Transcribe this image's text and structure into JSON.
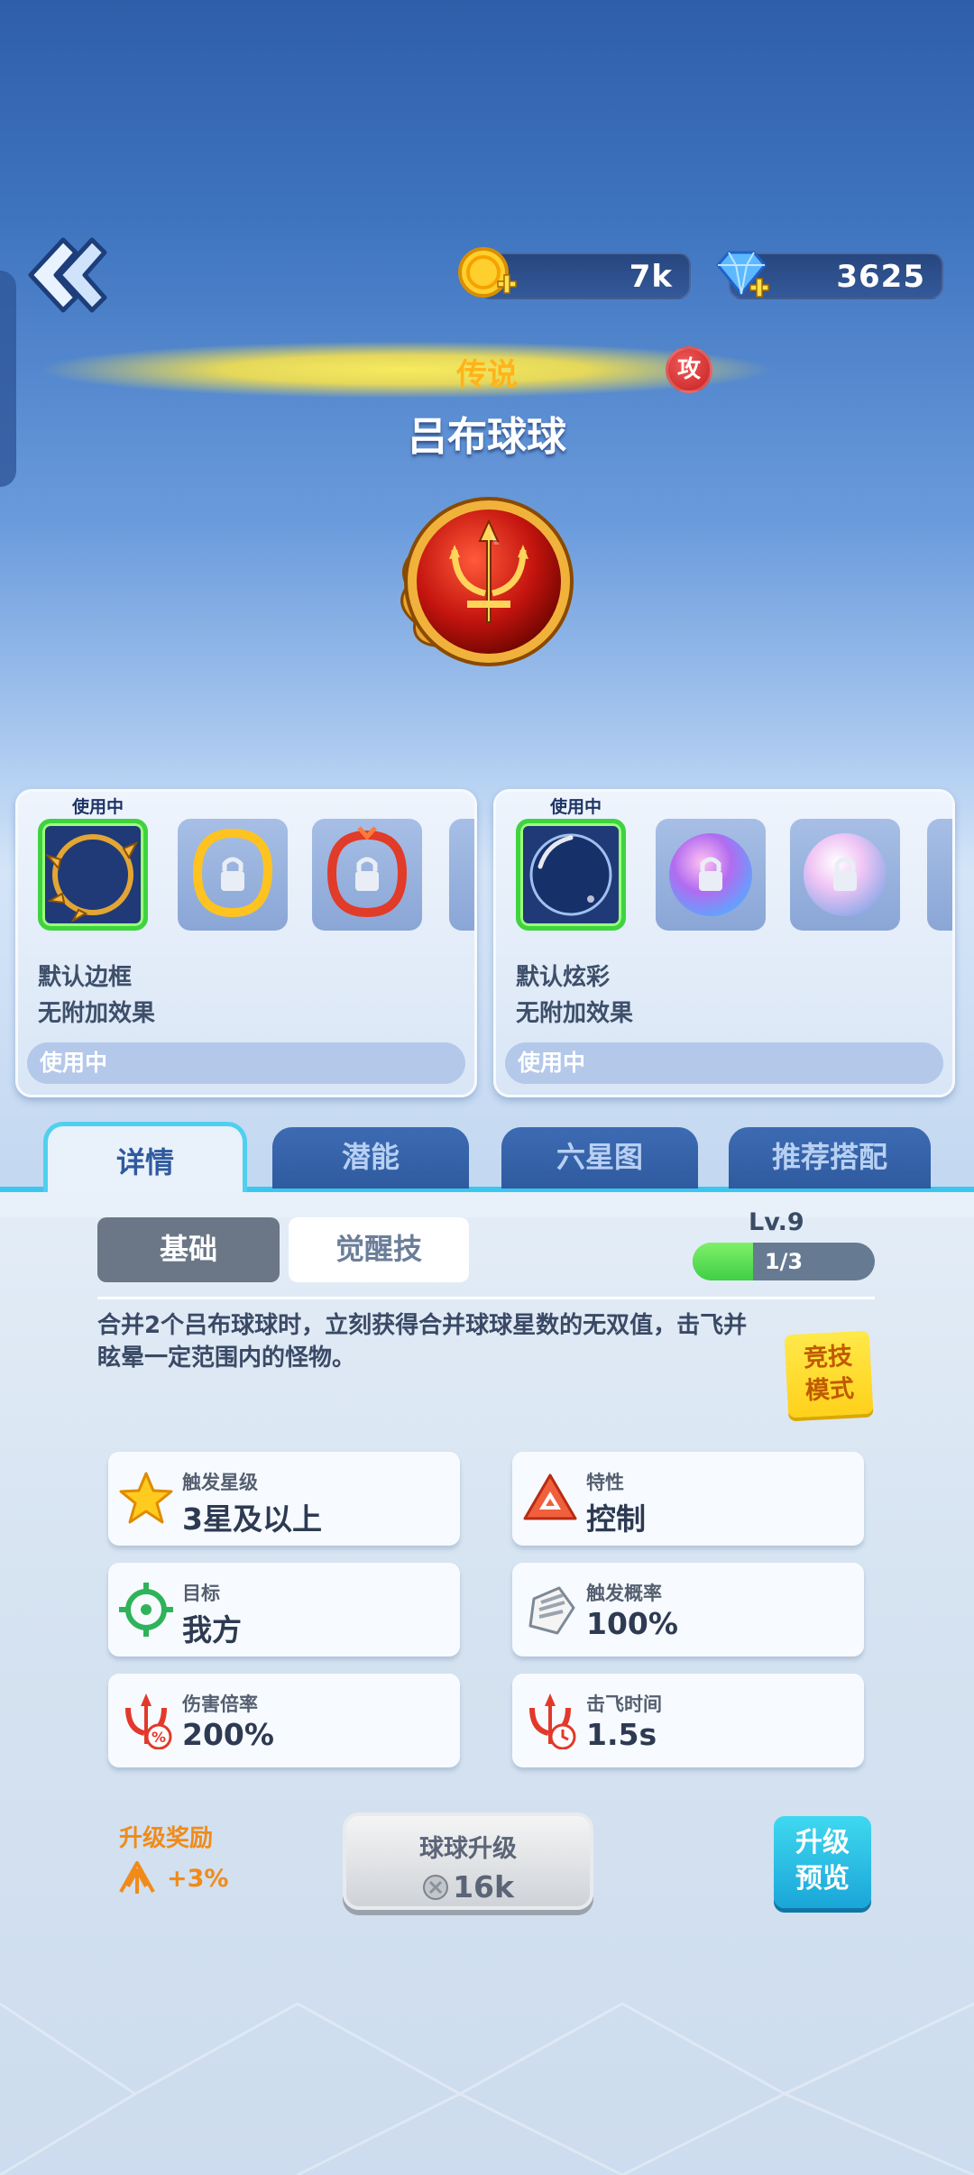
{
  "header": {
    "back_icon": "double-chevron-left-icon",
    "coins": {
      "icon": "coin-plus-icon",
      "value": "7k"
    },
    "gems": {
      "icon": "diamond-plus-icon",
      "value": "3625"
    }
  },
  "ball": {
    "rarity": "传说",
    "type_badge": "攻",
    "name": "吕布球球",
    "emblem_icon": "red-trident-orb-icon"
  },
  "frame_card": {
    "in_use_tag": "使用中",
    "slots": [
      "default-gold-thorn-frame",
      "locked-gold-frame",
      "locked-red-dragon-frame"
    ],
    "name": "默认边框",
    "effect": "无附加效果",
    "status": "使用中"
  },
  "effect_card": {
    "in_use_tag": "使用中",
    "slots": [
      "default-bubble-effect",
      "locked-rainbow-scale-effect",
      "locked-pearl-effect"
    ],
    "name": "默认炫彩",
    "effect": "无附加效果",
    "status": "使用中"
  },
  "tabs": [
    "详情",
    "潜能",
    "六星图",
    "推荐搭配"
  ],
  "subtabs": [
    "基础",
    "觉醒技"
  ],
  "level": {
    "label": "Lv.9",
    "progress_text": "1/3",
    "progress": 0.333
  },
  "description": "合并2个吕布球球时，立刻获得合并球球星数的无双值，击飞并眩晕一定范围内的怪物。",
  "mode_button": "竞技模式",
  "stats": [
    {
      "label": "触发星级",
      "value": "3星及以上",
      "icon": "star-icon"
    },
    {
      "label": "特性",
      "value": "控制",
      "icon": "control-triangle-icon"
    },
    {
      "label": "目标",
      "value": "我方",
      "icon": "target-crosshair-icon"
    },
    {
      "label": "触发概率",
      "value": "100%",
      "icon": "dice-hand-icon"
    },
    {
      "label": "伤害倍率",
      "value": "200%",
      "icon": "trident-percent-icon"
    },
    {
      "label": "击飞时间",
      "value": "1.5s",
      "icon": "trident-clock-icon"
    }
  ],
  "reward": {
    "title": "升级奖励",
    "value": "+3%",
    "icon": "trident-burst-icon"
  },
  "upgrade": {
    "label": "球球升级",
    "cost": "16k",
    "icon": "silver-coin-icon"
  },
  "preview_button": "升级预览",
  "colors": {
    "accent_cyan": "#3cc6ef",
    "select_green": "#3fd33f",
    "reward_orange": "#f08b1a",
    "legend_gold": "#ffb31a"
  }
}
